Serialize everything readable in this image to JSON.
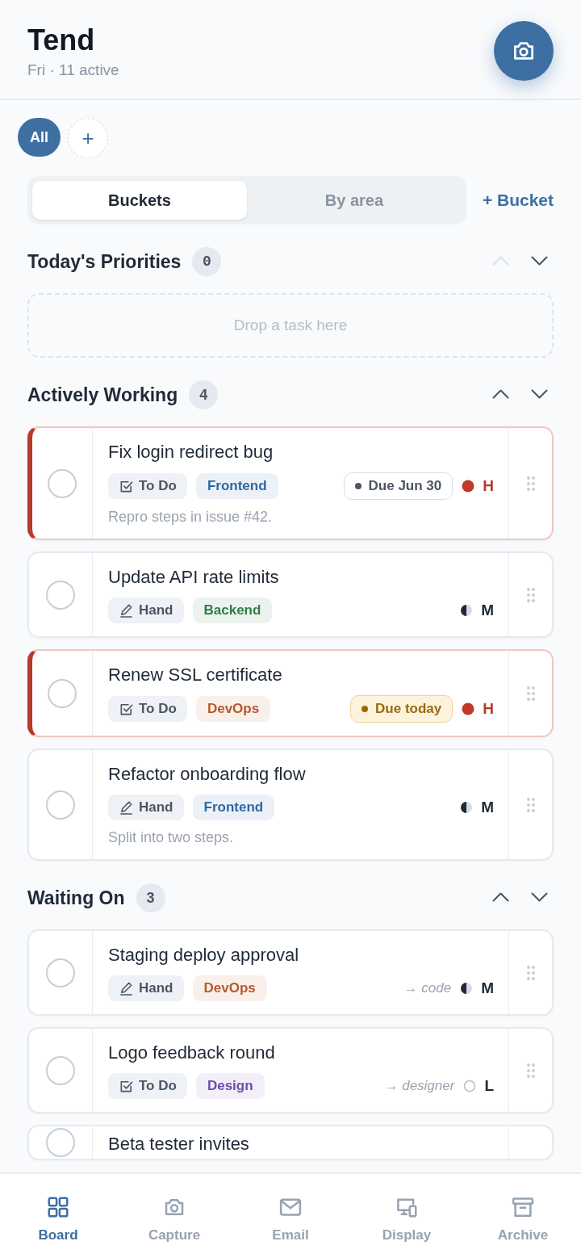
{
  "header": {
    "title": "Tend",
    "subtitle": "Fri · 11 active"
  },
  "filters": [
    {
      "label": "All",
      "selected": true
    }
  ],
  "add_filter": "+",
  "view_toggle": [
    {
      "label": "Buckets",
      "selected": true
    },
    {
      "label": "By area",
      "selected": false
    }
  ],
  "add_bucket": "+ Bucket",
  "sections": [
    {
      "title": "Today's Priorities",
      "count": "0",
      "move_up_disabled": true,
      "empty_text": "Drop a task here"
    },
    {
      "title": "Actively Working",
      "count": "4",
      "move_up_disabled": false,
      "tasks": [
        {
          "title": "Fix login redirect bug",
          "checked": false,
          "type": {
            "kind": "todo",
            "label": "To Do"
          },
          "tag": {
            "label": "Frontend",
            "color": "#2f67a3"
          },
          "due": {
            "kind": "date",
            "text": "Due Jun 30"
          },
          "priority": {
            "kind": "high",
            "label": "H"
          },
          "note": "Repro steps in issue #42."
        },
        {
          "title": "Update API rate limits",
          "checked": false,
          "type": {
            "kind": "hand",
            "label": "Hand"
          },
          "tag": {
            "label": "Backend",
            "color": "#2e7d45"
          },
          "priority": {
            "kind": "medium",
            "label": "M"
          }
        },
        {
          "title": "Renew SSL certificate",
          "checked": false,
          "type": {
            "kind": "todo",
            "label": "To Do"
          },
          "tag": {
            "label": "DevOps",
            "color": "#b8582b"
          },
          "due": {
            "kind": "today",
            "text": "Due today"
          },
          "priority": {
            "kind": "high",
            "label": "H"
          }
        },
        {
          "title": "Refactor onboarding flow",
          "checked": false,
          "type": {
            "kind": "hand",
            "label": "Hand"
          },
          "tag": {
            "label": "Frontend",
            "color": "#2f67a3"
          },
          "priority": {
            "kind": "medium",
            "label": "M"
          },
          "note": "Split into two steps."
        }
      ]
    },
    {
      "title": "Waiting On",
      "count": "3",
      "move_up_disabled": false,
      "tasks": [
        {
          "title": "Staging deploy approval",
          "checked": false,
          "type": {
            "kind": "hand",
            "label": "Hand"
          },
          "tag": {
            "label": "DevOps",
            "color": "#b8582b"
          },
          "delegate": "→ code",
          "priority": {
            "kind": "medium",
            "label": "M"
          }
        },
        {
          "title": "Logo feedback round",
          "checked": false,
          "type": {
            "kind": "todo",
            "label": "To Do"
          },
          "tag": {
            "label": "Design",
            "color": "#6a4bad"
          },
          "delegate": "→ designer",
          "priority": {
            "kind": "low",
            "label": "L"
          }
        },
        {
          "title": "Beta tester invites",
          "checked": false
        }
      ]
    }
  ],
  "nav": [
    {
      "label": "Board",
      "kind": "grid",
      "selected": true
    },
    {
      "label": "Capture",
      "kind": "camera",
      "selected": false
    },
    {
      "label": "Email",
      "kind": "mail",
      "selected": false
    },
    {
      "label": "Display",
      "kind": "devices",
      "selected": false
    },
    {
      "label": "Archive",
      "kind": "archive",
      "selected": false
    }
  ]
}
